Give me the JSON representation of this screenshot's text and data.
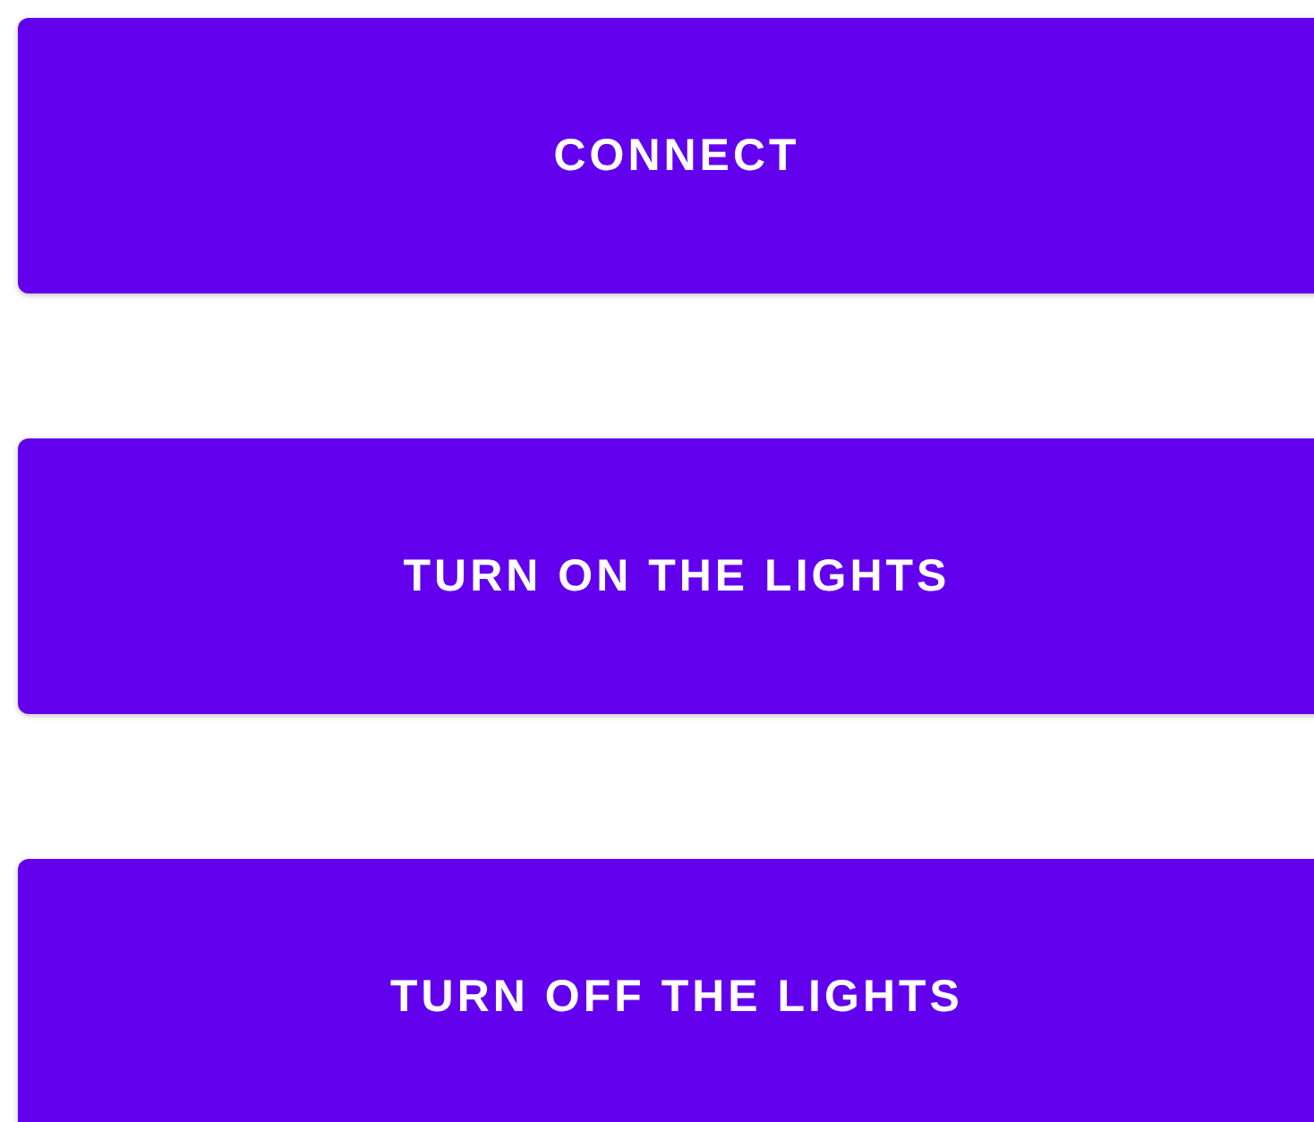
{
  "buttons": [
    {
      "label": "CONNECT"
    },
    {
      "label": "TURN ON THE LIGHTS"
    },
    {
      "label": "TURN OFF THE LIGHTS"
    }
  ]
}
